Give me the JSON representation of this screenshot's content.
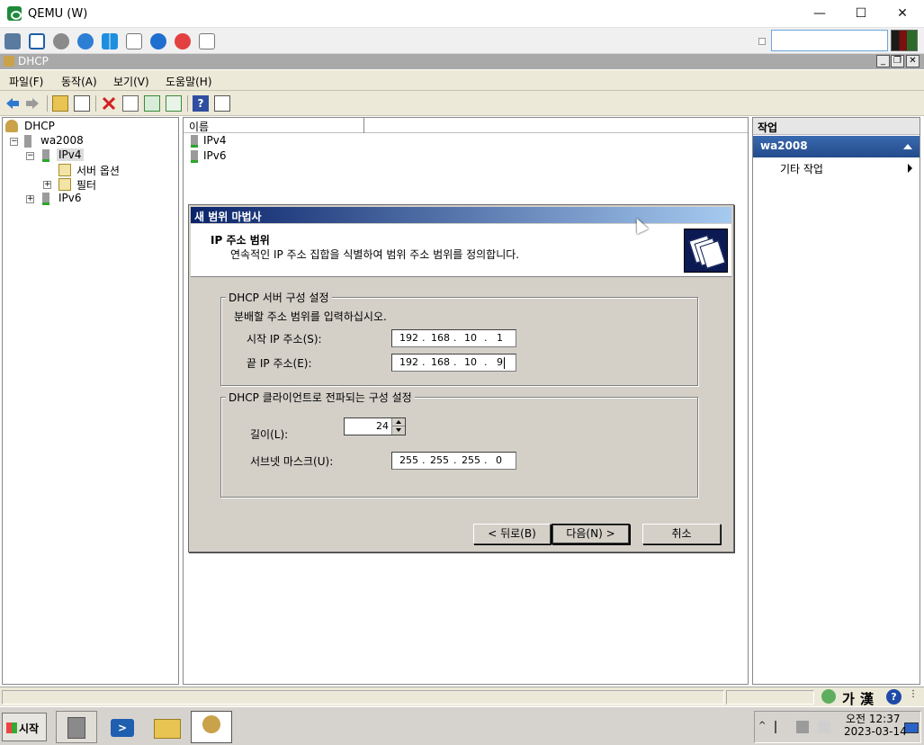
{
  "qemu": {
    "title": "QEMU (W)",
    "min": "—",
    "max": "☐",
    "close": "✕"
  },
  "mmc": {
    "title": "DHCP",
    "menu": [
      "파일(F)",
      "동작(A)",
      "보기(V)",
      "도움말(H)"
    ]
  },
  "tree": {
    "root": "DHCP",
    "server": "wa2008",
    "ipv4": "IPv4",
    "server_options": "서버 옵션",
    "filters": "필터",
    "ipv6": "IPv6"
  },
  "center": {
    "column_name": "이름",
    "rows": [
      "IPv4",
      "IPv6"
    ]
  },
  "actions": {
    "header": "작업",
    "selected": "wa2008",
    "more": "기타 작업"
  },
  "wizard": {
    "title": "새 범위 마법사",
    "heading": "IP 주소 범위",
    "subtitle": "연속적인 IP 주소 집합을 식별하여 범위 주소 범위를 정의합니다.",
    "group1_title": "DHCP 서버 구성 설정",
    "group1_instruction": "분배할 주소 범위를 입력하십시오.",
    "start_ip_label": "시작 IP 주소(S):",
    "start_ip": [
      "192",
      "168",
      "10",
      "1"
    ],
    "end_ip_label": "끝 IP 주소(E):",
    "end_ip": [
      "192",
      "168",
      "10",
      "9"
    ],
    "group2_title": "DHCP 클라이언트로 전파되는 구성 설정",
    "length_label": "길이(L):",
    "length_value": "24",
    "subnet_label": "서브넷 마스크(U):",
    "subnet": [
      "255",
      "255",
      "255",
      "0"
    ],
    "back_button": "< 뒤로(B)",
    "next_button": "다음(N) >",
    "cancel_button": "취소"
  },
  "statusbar": {
    "lang_ga": "가",
    "lang_han": "漢"
  },
  "taskbar": {
    "start": "시작",
    "clock_time": "오전 12:37",
    "clock_date": "2023-03-14"
  }
}
